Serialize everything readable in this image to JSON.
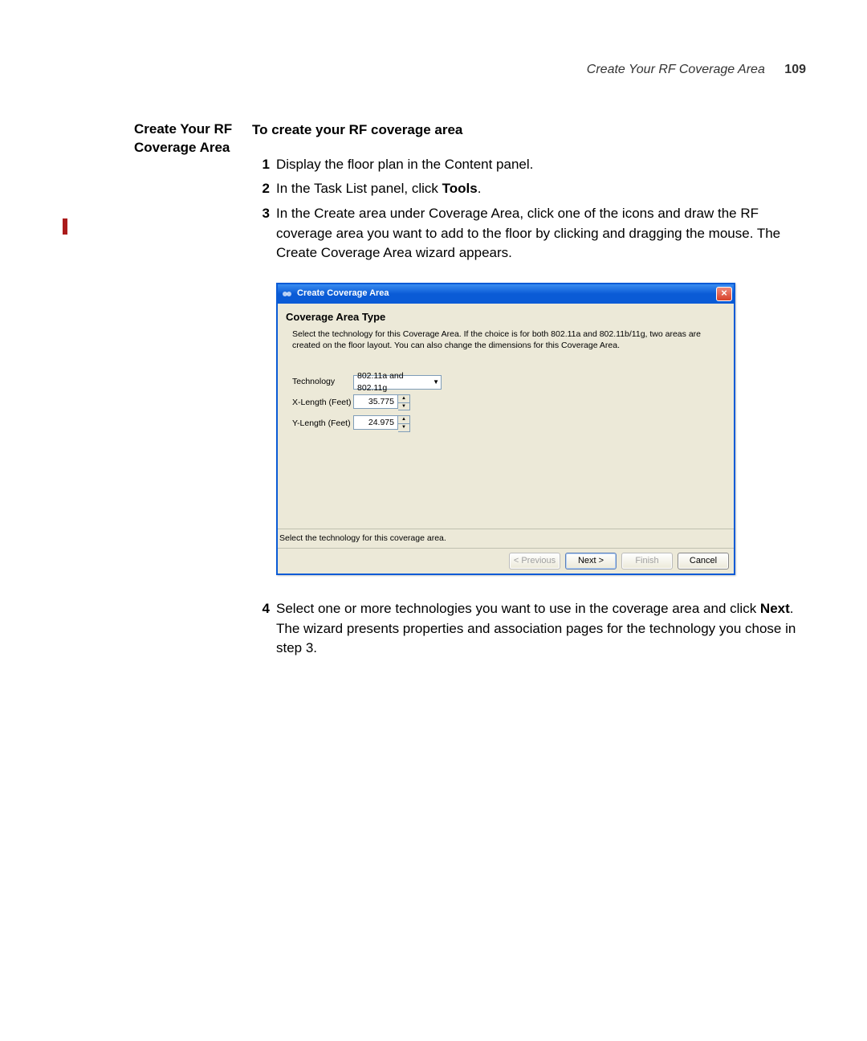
{
  "header": {
    "running_title": "Create Your RF Coverage Area",
    "page_number": "109"
  },
  "section": {
    "title_line1": "Create Your RF",
    "title_line2": "Coverage Area",
    "subheading": "To create your RF coverage area",
    "steps": [
      {
        "num": "1",
        "text": "Display the floor plan in the Content panel."
      },
      {
        "num": "2",
        "pre": "In the Task List panel, click ",
        "bold": "Tools",
        "post": "."
      },
      {
        "num": "3",
        "text": "In the Create area under Coverage Area, click one of the icons and draw the RF coverage area you want to add to the floor by clicking and dragging the mouse. The Create Coverage Area wizard appears."
      },
      {
        "num": "4",
        "pre": "Select one or more technologies you want to use in the coverage area and click ",
        "bold": "Next",
        "post": ". The wizard presents properties and association pages for the technology you chose in step 3."
      }
    ]
  },
  "dialog": {
    "title": "Create Coverage Area",
    "heading": "Coverage Area Type",
    "description": "Select the technology for this Coverage Area. If the choice is for both 802.11a and 802.11b/11g, two areas are created on the floor layout. You can also change the dimensions for this Coverage Area.",
    "fields": {
      "technology": {
        "label": "Technology",
        "value": "802.11a and 802.11g"
      },
      "xlen": {
        "label": "X-Length (Feet)",
        "value": "35.775"
      },
      "ylen": {
        "label": "Y-Length (Feet)",
        "value": "24.975"
      }
    },
    "status": "Select the technology for this coverage area.",
    "buttons": {
      "previous": "< Previous",
      "next": "Next >",
      "finish": "Finish",
      "cancel": "Cancel"
    }
  }
}
